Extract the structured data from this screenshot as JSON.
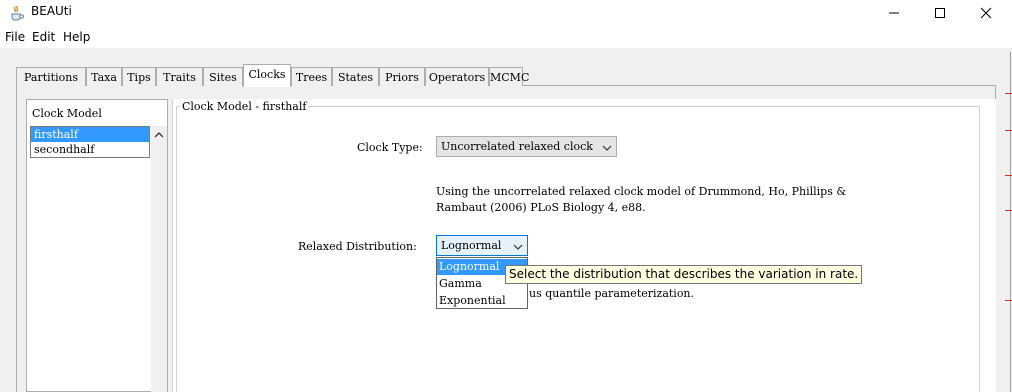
{
  "window": {
    "title": "BEAUti",
    "icons": {
      "app": "java-cup-icon",
      "minimize": "minimize-icon",
      "maximize": "maximize-icon",
      "close": "close-icon"
    }
  },
  "menu": {
    "file": "File",
    "edit": "Edit",
    "help": "Help"
  },
  "tabs": [
    "Partitions",
    "Taxa",
    "Tips",
    "Traits",
    "Sites",
    "Clocks",
    "Trees",
    "States",
    "Priors",
    "Operators",
    "MCMC"
  ],
  "active_tab": "Clocks",
  "clock_list": {
    "header": "Clock Model",
    "items": [
      "firsthalf",
      "secondhalf"
    ],
    "selected": "firsthalf"
  },
  "panel": {
    "group_title": "Clock Model - firsthalf",
    "clock_type_label": "Clock Type:",
    "clock_type_value": "Uncorrelated relaxed clock",
    "description_line1": "Using the uncorrelated relaxed clock model of Drummond, Ho, Phillips &",
    "description_line2": "Rambaut (2006) PLoS Biology 4, e88.",
    "relaxed_label": "Relaxed Distribution:",
    "relaxed_value": "Lognormal",
    "partial_text": "us quantile parameterization."
  },
  "dropdown": {
    "options": [
      "Lognormal",
      "Gamma",
      "Exponential"
    ],
    "highlighted": "Lognormal"
  },
  "tooltip": "Select the distribution that describes the variation in rate.",
  "colors": {
    "selection": "#3399ff",
    "tooltip_bg": "#ffffe1"
  }
}
